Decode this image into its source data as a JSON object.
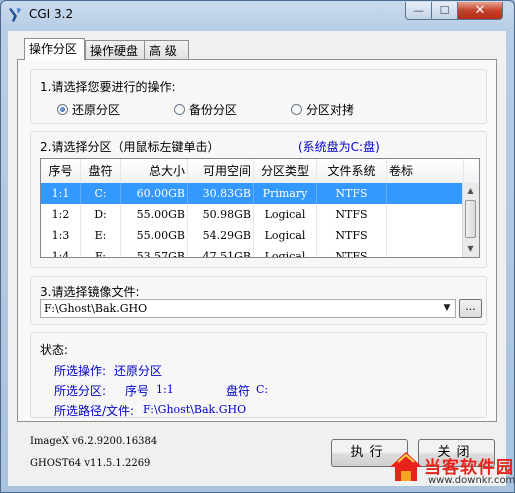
{
  "window": {
    "title": "CGI 3.2",
    "buttons": {
      "minimize": "—",
      "maximize": "☐",
      "close": "✕"
    }
  },
  "tabs": [
    {
      "label": "操作分区",
      "active": true
    },
    {
      "label": "操作硬盘",
      "active": false
    },
    {
      "label": "高 级",
      "active": false
    }
  ],
  "step1": {
    "title": "1.请选择您要进行的操作:",
    "options": [
      {
        "label": "还原分区",
        "selected": true
      },
      {
        "label": "备份分区",
        "selected": false
      },
      {
        "label": "分区对拷",
        "selected": false
      }
    ]
  },
  "step2": {
    "title": "2.请选择分区（用鼠标左键单击）",
    "system_disk_note": "(系统盘为C:盘)",
    "columns": [
      "序号",
      "盘符",
      "总大小",
      "可用空间",
      "分区类型",
      "文件系统",
      "卷标"
    ],
    "rows": [
      [
        "1:1",
        "C:",
        "60.00GB",
        "30.83GB",
        "Primary",
        "NTFS",
        ""
      ],
      [
        "1:2",
        "D:",
        "55.00GB",
        "50.98GB",
        "Logical",
        "NTFS",
        ""
      ],
      [
        "1:3",
        "E:",
        "55.00GB",
        "54.29GB",
        "Logical",
        "NTFS",
        ""
      ],
      [
        "1:4",
        "F:",
        "53.57GB",
        "47.51GB",
        "Logical",
        "NTFS",
        ""
      ]
    ],
    "selected_row": 0
  },
  "step3": {
    "title": "3.请选择镜像文件:",
    "image_path": "F:\\Ghost\\Bak.GHO",
    "browse_label": "..."
  },
  "status": {
    "title": "状态:",
    "operation_label": "所选操作:",
    "operation_value": "还原分区",
    "partition_label": "所选分区:",
    "partition_index_label": "序号",
    "partition_index": "1:1",
    "partition_drive_label": "盘符",
    "partition_drive": "C:",
    "path_label": "所选路径/文件:",
    "path_value": "F:\\Ghost\\Bak.GHO"
  },
  "footer": {
    "imagex_version": "ImageX v6.2.9200.16384",
    "ghost_version": "GHOST64 v11.5.1.2269",
    "execute_label": "执行",
    "close_label": "关闭"
  },
  "watermark": {
    "brand": "当客软件园",
    "url": "www.downkr.com"
  },
  "colors": {
    "selection": "#3399ff",
    "status_text": "#0000cc",
    "watermark_red": "#e8231b"
  }
}
